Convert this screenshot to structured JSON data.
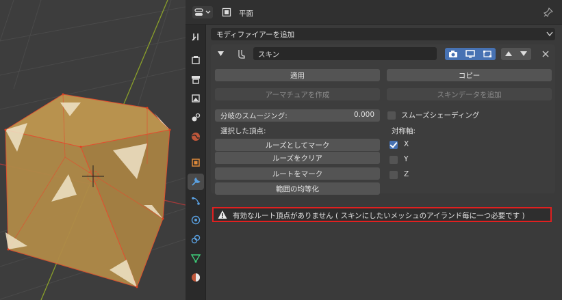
{
  "header": {
    "object_name": "平面",
    "icons": {
      "editor_type": "properties-editor-icon",
      "object": "object-data-icon",
      "pin": "pin-icon"
    }
  },
  "add_modifier": {
    "label": "モディファイアーを追加"
  },
  "modifier": {
    "name": "スキン",
    "icons": [
      "expand-arrow-icon",
      "skin-modifier-icon",
      "camera-icon",
      "monitor-icon",
      "editmode-icon",
      "move-up-icon",
      "move-down-icon",
      "close-icon"
    ]
  },
  "buttons": {
    "apply": "適用",
    "copy": "コピー",
    "create_armature": "アーマチュアを作成",
    "add_skin_data": "スキンデータを追加",
    "mark_loose": "ルーズとしてマーク",
    "clear_loose": "ルーズをクリア",
    "mark_root": "ルートをマーク",
    "equalize": "範囲の均等化"
  },
  "branch_smoothing": {
    "label": "分岐のスムージング:",
    "value": "0.000"
  },
  "smooth_shading": {
    "label": "スムーズシェーディング",
    "checked": false
  },
  "selected_vertices_label": "選択した頂点:",
  "symmetry": {
    "label": "対称軸:",
    "axes": [
      {
        "label": "X",
        "checked": true
      },
      {
        "label": "Y",
        "checked": false
      },
      {
        "label": "Z",
        "checked": false
      }
    ]
  },
  "warning": {
    "text": "有効なルート頂点がありません ( スキンにしたいメッシュのアイランド毎に一つ必要です )",
    "border_color": "#e02020"
  },
  "sidebar_tabs": [
    "tool-icon",
    "render-icon",
    "output-icon",
    "view-layer-icon",
    "scene-icon",
    "world-icon",
    "object-icon",
    "modifier-icon",
    "particles-icon",
    "physics-icon",
    "constraints-icon",
    "data-icon",
    "material-icon"
  ],
  "colors": {
    "accent": "#4772b3",
    "panel": "#3a3a3a",
    "button": "#545454",
    "mesh": "#a8844a",
    "edge": "#e05030"
  }
}
